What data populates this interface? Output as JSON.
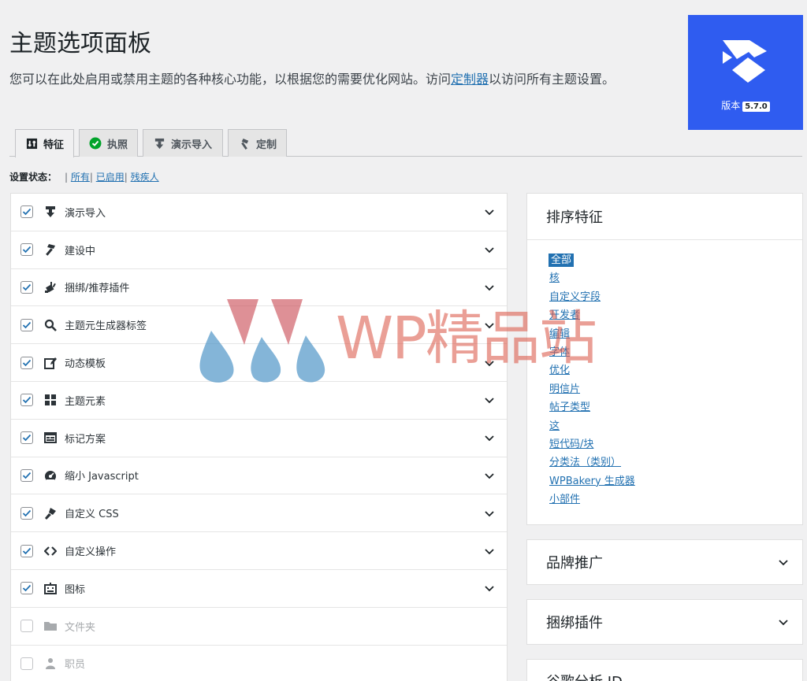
{
  "header": {
    "title": "主题选项面板",
    "description_before": "您可以在此处启用或禁用主题的各种核心功能，以根据您的需要优化网站。访问",
    "description_link": "定制器",
    "description_after": "以访问所有主题设置。"
  },
  "version_box": {
    "label": "版本",
    "number": "5.7.0",
    "brand_color": "#2f5cf0"
  },
  "tabs": [
    {
      "label": "特征",
      "icon": "sliders-icon",
      "active": true
    },
    {
      "label": "执照",
      "icon": "check-circle-icon",
      "active": false
    },
    {
      "label": "演示导入",
      "icon": "download-icon",
      "active": false
    },
    {
      "label": "定制",
      "icon": "hammer-icon",
      "active": false
    }
  ],
  "status_filter": {
    "label": "设置状态：",
    "links": [
      "所有",
      "已启用",
      "残疾人"
    ]
  },
  "features": [
    {
      "label": "演示导入",
      "icon": "download-icon",
      "checked": true
    },
    {
      "label": "建设中",
      "icon": "hammer-icon",
      "checked": true
    },
    {
      "label": "捆绑/推荐插件",
      "icon": "plugin-icon",
      "checked": true
    },
    {
      "label": "主题元生成器标签",
      "icon": "search-icon",
      "checked": true
    },
    {
      "label": "动态模板",
      "icon": "edit-page-icon",
      "checked": true
    },
    {
      "label": "主题元素",
      "icon": "grid-icon",
      "checked": true
    },
    {
      "label": "标记方案",
      "icon": "id-card-icon",
      "checked": true
    },
    {
      "label": "缩小 Javascript",
      "icon": "dashboard-icon",
      "checked": true
    },
    {
      "label": "自定义 CSS",
      "icon": "brush-icon",
      "checked": true
    },
    {
      "label": "自定义操作",
      "icon": "code-icon",
      "checked": true
    },
    {
      "label": "图标",
      "icon": "robot-icon",
      "checked": true
    },
    {
      "label": "文件夹",
      "icon": "folder-icon",
      "checked": false
    },
    {
      "label": "职员",
      "icon": "person-icon",
      "checked": false
    }
  ],
  "sort_box": {
    "title": "排序特征",
    "items": [
      "全部",
      "核",
      "自定义字段",
      "开发者",
      "编辑",
      "字体",
      "优化",
      "明信片",
      "帖子类型",
      "这",
      "短代码/块",
      "分类法（类别）",
      "WPBakery 生成器",
      "小部件"
    ],
    "current": "全部"
  },
  "side_boxes": {
    "brand": "品牌推广",
    "bundle": "捆绑插件",
    "ga": "谷歌分析 ID"
  },
  "watermark": {
    "text": "WP精品站"
  },
  "colors": {
    "link": "#2271b1",
    "background": "#f0f0f1",
    "accent": "#2f5cf0"
  }
}
